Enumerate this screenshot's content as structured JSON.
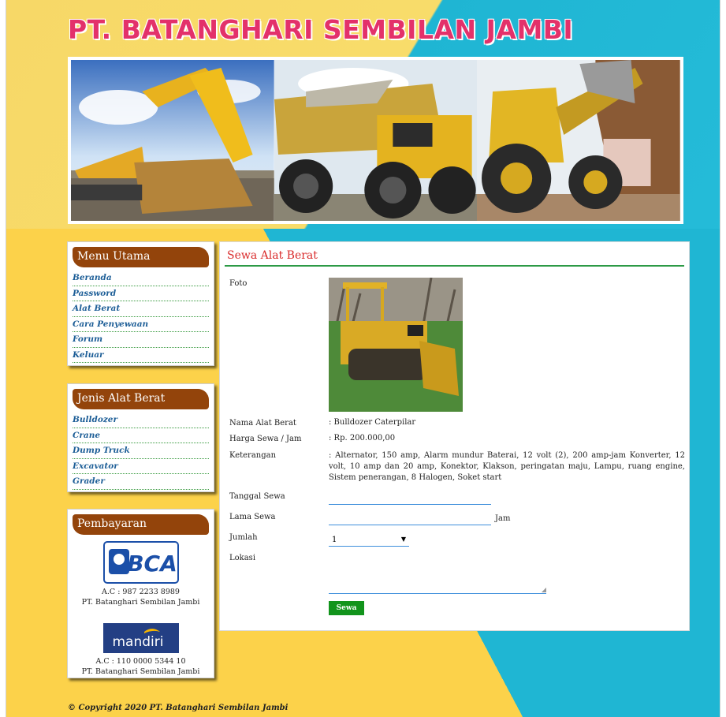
{
  "site": {
    "title": "PT. BATANGHARI SEMBILAN JAMBI"
  },
  "sidebar": {
    "menu_utama": {
      "heading": "Menu Utama",
      "items": [
        "Beranda",
        "Password",
        "Alat Berat",
        "Cara Penyewaan",
        "Forum",
        "Keluar"
      ]
    },
    "jenis_alat": {
      "heading": "Jenis Alat Berat",
      "items": [
        "Bulldozer",
        "Crane",
        "Dump Truck",
        "Excavator",
        "Grader"
      ]
    },
    "pembayaran": {
      "heading": "Pembayaran",
      "banks": [
        {
          "logo": "BCA",
          "account": "A.C : 987 2233 8989",
          "holder": "PT. Batanghari Sembilan Jambi"
        },
        {
          "logo": "mandiri",
          "account": "A.C : 110 0000 5344 10",
          "holder": "PT. Batanghari Sembilan Jambi"
        }
      ]
    }
  },
  "main": {
    "title": "Sewa Alat Berat",
    "labels": {
      "foto": "Foto",
      "nama": "Nama Alat Berat",
      "harga": "Harga Sewa / Jam",
      "keterangan": "Keterangan",
      "tanggal": "Tanggal Sewa",
      "lama": "Lama Sewa",
      "jumlah": "Jumlah",
      "lokasi": "Lokasi"
    },
    "values": {
      "nama": ": Bulldozer Caterpilar",
      "harga": ": Rp. 200.000,00",
      "keterangan": ": Alternator, 150 amp, Alarm mundur Baterai, 12 volt (2), 200 amp-jam Konverter, 12 volt, 10 amp dan 20 amp, Konektor, Klakson, peringatan maju, Lampu, ruang engine, Sistem penerangan, 8 Halogen, Soket start"
    },
    "lama_unit": "Jam",
    "jumlah_selected": "1",
    "submit_label": "Sewa"
  },
  "footer": {
    "copyright": "© Copyright 2020 PT. Batanghari Sembilan Jambi"
  },
  "colors": {
    "heading_brown": "#93440b",
    "link_blue": "#1d5e97",
    "title_red": "#d92a2a",
    "submit_green": "#12941c",
    "site_title_pink": "#e3316a"
  },
  "icons": [
    "bca-logo",
    "mandiri-logo",
    "select-caret-icon",
    "resize-grip-icon"
  ]
}
